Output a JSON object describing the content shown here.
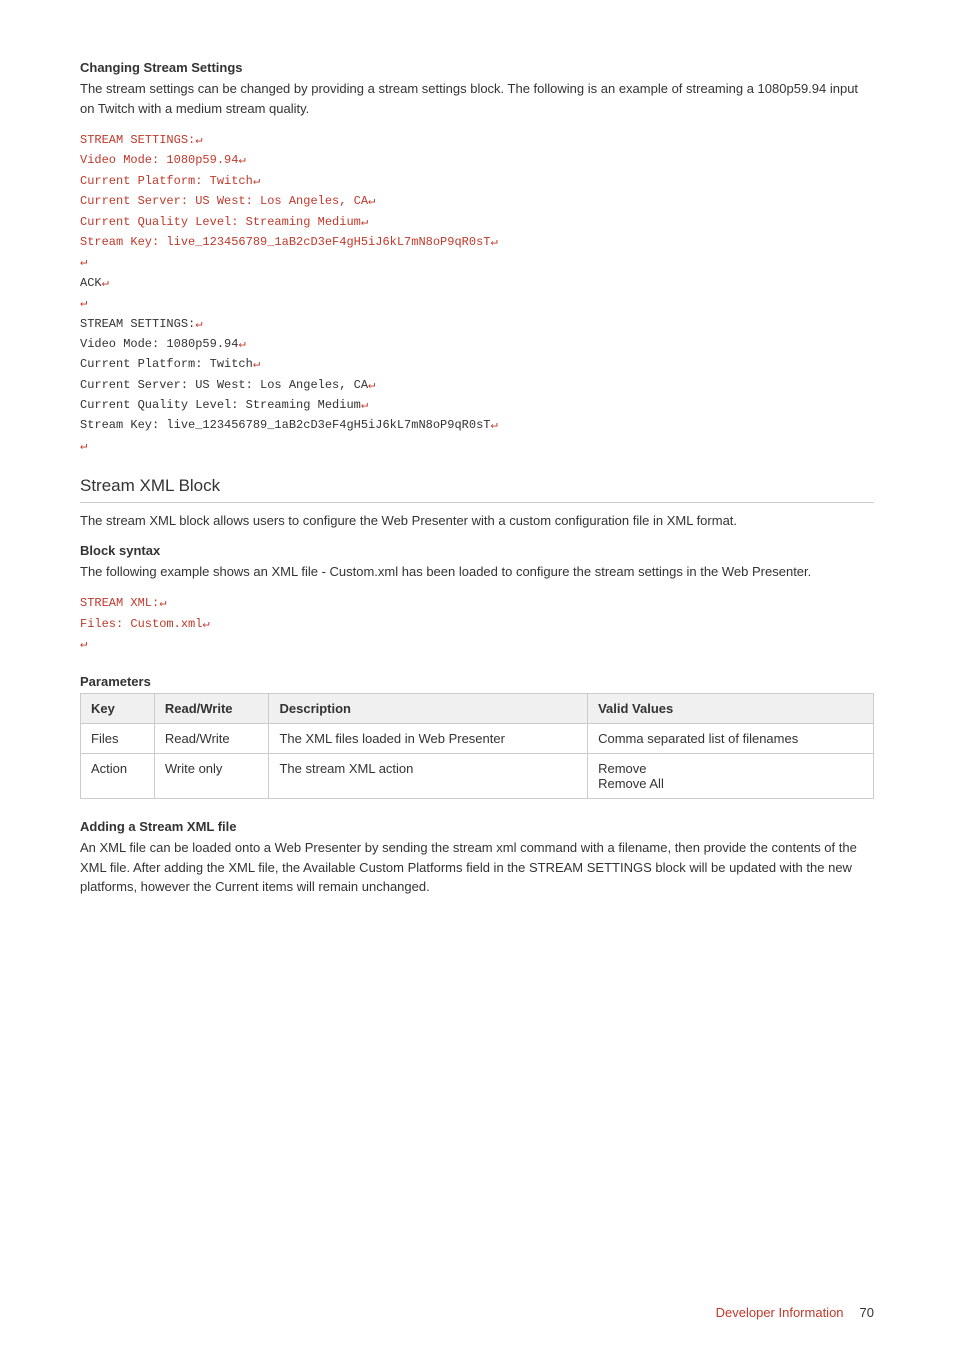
{
  "sections": {
    "changing_stream_settings": {
      "heading": "Changing Stream Settings",
      "description": "The stream settings can be changed by providing a stream settings block. The following is an example of streaming a 1080p59.94 input on Twitch with a medium stream quality.",
      "code_block_1": [
        "STREAM SETTINGS:↵",
        "Video Mode: 1080p59.94↵",
        "Current Platform: Twitch↵",
        "Current Server: US West: Los Angeles, CA↵",
        "Current Quality Level: Streaming Medium↵",
        "Stream Key: live_123456789_1aB2cD3eF4gH5iJ6kL7mN8oP9qR0sT↵",
        "↵",
        "ACK↵",
        "↵",
        "STREAM SETTINGS:↵",
        "Video Mode: 1080p59.94↵",
        "Current Platform: Twitch↵",
        "Current Server: US West: Los Angeles, CA↵",
        "Current Quality Level: Streaming Medium↵",
        "Stream Key: live_123456789_1aB2cD3eF4gH5iJ6kL7mN8oP9qR0sT↵",
        "↵"
      ]
    },
    "stream_xml_block": {
      "heading": "Stream XML Block",
      "description": "The stream XML block allows users to configure the Web Presenter with a custom configuration file in XML format.",
      "block_syntax": {
        "heading": "Block syntax",
        "description": "The following example shows an XML file - Custom.xml has been loaded to configure the stream settings in the Web Presenter.",
        "code_block": [
          "STREAM XML:↵",
          "Files: Custom.xml↵",
          "↵"
        ]
      },
      "parameters": {
        "heading": "Parameters",
        "table": {
          "headers": [
            "Key",
            "Read/Write",
            "Description",
            "Valid Values"
          ],
          "rows": [
            {
              "key": "Files",
              "read_write": "Read/Write",
              "description": "The XML files loaded in Web Presenter",
              "valid_values": "Comma separated list of filenames"
            },
            {
              "key": "Action",
              "read_write": "Write only",
              "description": "The stream XML action",
              "valid_values": "Remove\nRemove All"
            }
          ]
        }
      },
      "adding_xml": {
        "heading": "Adding a Stream XML file",
        "description": "An XML file can be loaded onto a Web Presenter by sending the stream xml command with a filename, then provide the contents of the XML file. After adding the XML file, the Available Custom Platforms field in the STREAM SETTINGS block will be updated with the new platforms, however the Current items will remain unchanged."
      }
    }
  },
  "footer": {
    "link_text": "Developer Information",
    "page_number": "70"
  }
}
